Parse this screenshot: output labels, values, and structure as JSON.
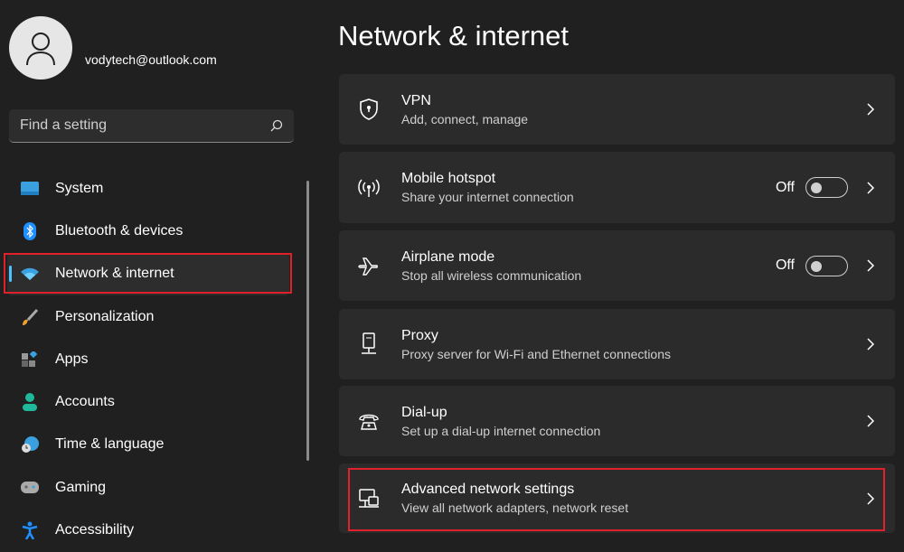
{
  "user": {
    "email": "vodytech@outlook.com"
  },
  "search": {
    "placeholder": "Find a setting"
  },
  "sidebar": {
    "items": [
      {
        "label": "System",
        "icon": "system-icon",
        "selected": false
      },
      {
        "label": "Bluetooth & devices",
        "icon": "bluetooth-icon",
        "selected": false
      },
      {
        "label": "Network & internet",
        "icon": "wifi-icon",
        "selected": true
      },
      {
        "label": "Personalization",
        "icon": "brush-icon",
        "selected": false
      },
      {
        "label": "Apps",
        "icon": "apps-icon",
        "selected": false
      },
      {
        "label": "Accounts",
        "icon": "accounts-icon",
        "selected": false
      },
      {
        "label": "Time & language",
        "icon": "time-language-icon",
        "selected": false
      },
      {
        "label": "Gaming",
        "icon": "gaming-icon",
        "selected": false
      },
      {
        "label": "Accessibility",
        "icon": "accessibility-icon",
        "selected": false
      }
    ]
  },
  "main": {
    "title": "Network & internet",
    "items": [
      {
        "title": "VPN",
        "subtitle": "Add, connect, manage",
        "icon": "vpn-shield-icon"
      },
      {
        "title": "Mobile hotspot",
        "subtitle": "Share your internet connection",
        "icon": "hotspot-icon",
        "state": "Off",
        "toggle_on": false
      },
      {
        "title": "Airplane mode",
        "subtitle": "Stop all wireless communication",
        "icon": "airplane-icon",
        "state": "Off",
        "toggle_on": false
      },
      {
        "title": "Proxy",
        "subtitle": "Proxy server for Wi-Fi and Ethernet connections",
        "icon": "proxy-icon"
      },
      {
        "title": "Dial-up",
        "subtitle": "Set up a dial-up internet connection",
        "icon": "dialup-icon"
      },
      {
        "title": "Advanced network settings",
        "subtitle": "View all network adapters, network reset",
        "icon": "advanced-network-icon"
      }
    ]
  },
  "colors": {
    "accent": "#4cc2ff",
    "highlight": "#e0202a",
    "background": "#202020",
    "card": "#2b2b2b"
  }
}
